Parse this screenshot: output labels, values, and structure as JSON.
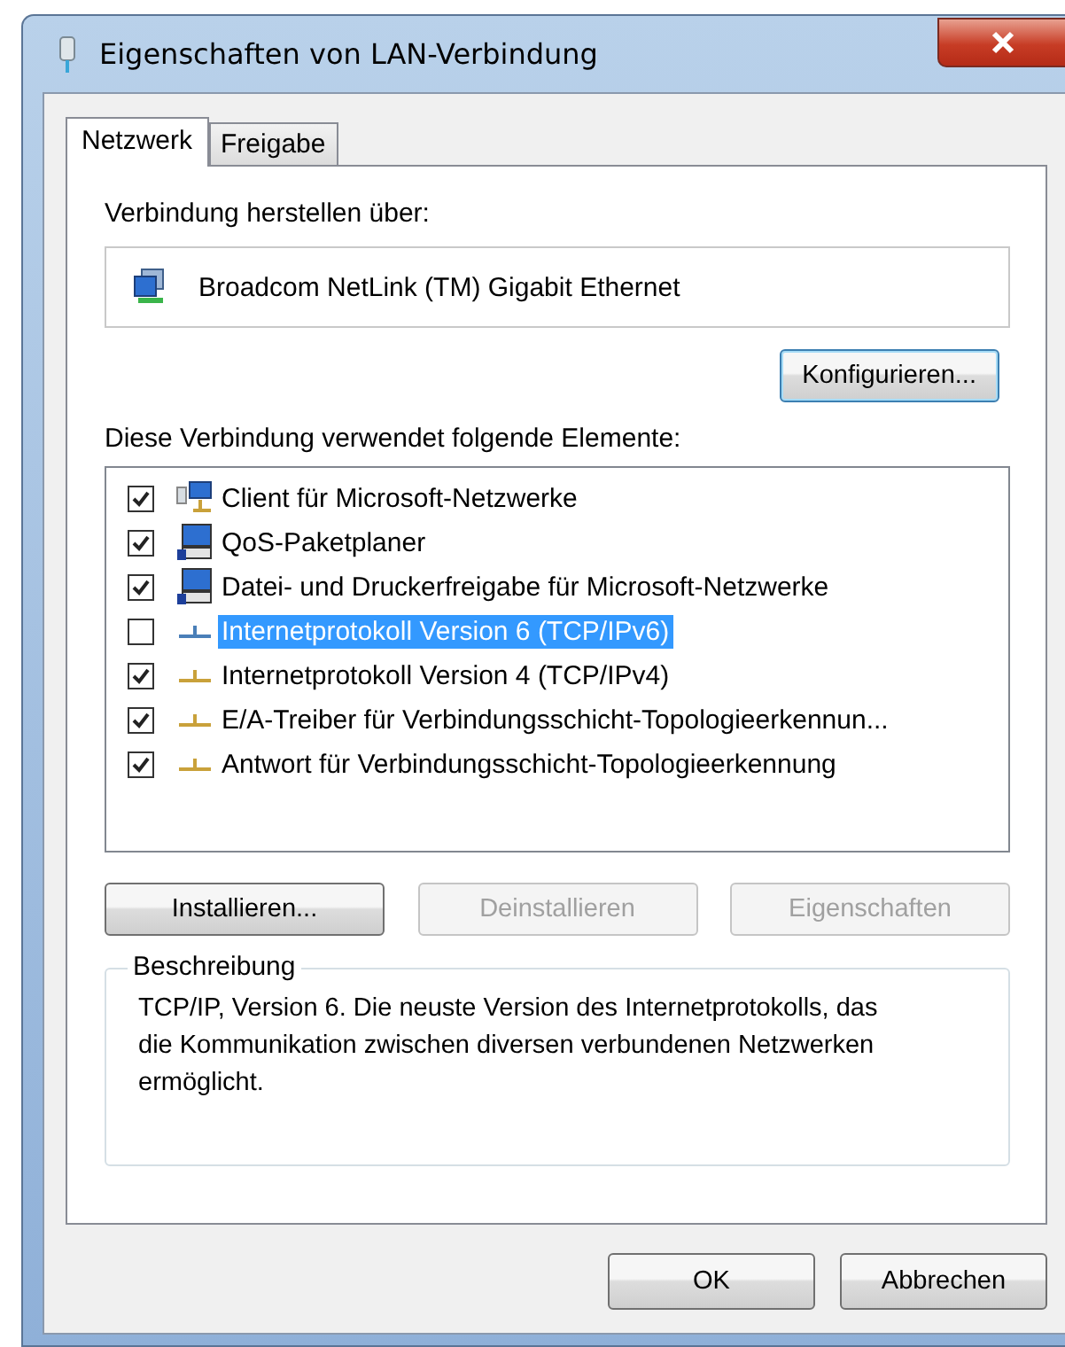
{
  "window": {
    "title": "Eigenschaften von LAN-Verbindung"
  },
  "tabs": [
    {
      "label": "Netzwerk",
      "selected": true
    },
    {
      "label": "Freigabe",
      "selected": false
    }
  ],
  "connect_via": {
    "label": "Verbindung herstellen über:",
    "adapter": "Broadcom NetLink (TM) Gigabit Ethernet",
    "button": "Konfigurieren..."
  },
  "elements": {
    "label": "Diese Verbindung verwendet folgende Elemente:",
    "items": [
      {
        "kind": "client",
        "label": "Client für Microsoft-Netzwerke",
        "checked": true,
        "selected": false
      },
      {
        "kind": "service",
        "label": "QoS-Paketplaner",
        "checked": true,
        "selected": false
      },
      {
        "kind": "service",
        "label": "Datei- und Druckerfreigabe für Microsoft-Netzwerke",
        "checked": true,
        "selected": false
      },
      {
        "kind": "protocol",
        "label": "Internetprotokoll Version 6 (TCP/IPv6)",
        "checked": false,
        "selected": true
      },
      {
        "kind": "protocol",
        "label": "Internetprotokoll Version 4 (TCP/IPv4)",
        "checked": true,
        "selected": false
      },
      {
        "kind": "protocol",
        "label": "E/A-Treiber für Verbindungsschicht-Topologieerkennun...",
        "checked": true,
        "selected": false
      },
      {
        "kind": "protocol",
        "label": "Antwort für Verbindungsschicht-Topologieerkennung",
        "checked": true,
        "selected": false
      }
    ]
  },
  "item_buttons": [
    {
      "label": "Installieren...",
      "disabled": false
    },
    {
      "label": "Deinstallieren",
      "disabled": true
    },
    {
      "label": "Eigenschaften",
      "disabled": true
    }
  ],
  "description": {
    "title": "Beschreibung",
    "text": "TCP/IP, Version 6. Die neuste Version des Internetprotokolls, das die Kommunikation zwischen diversen verbundenen Netzwerken ermöglicht."
  },
  "dialog_buttons": [
    {
      "label": "OK"
    },
    {
      "label": "Abbrechen"
    }
  ]
}
